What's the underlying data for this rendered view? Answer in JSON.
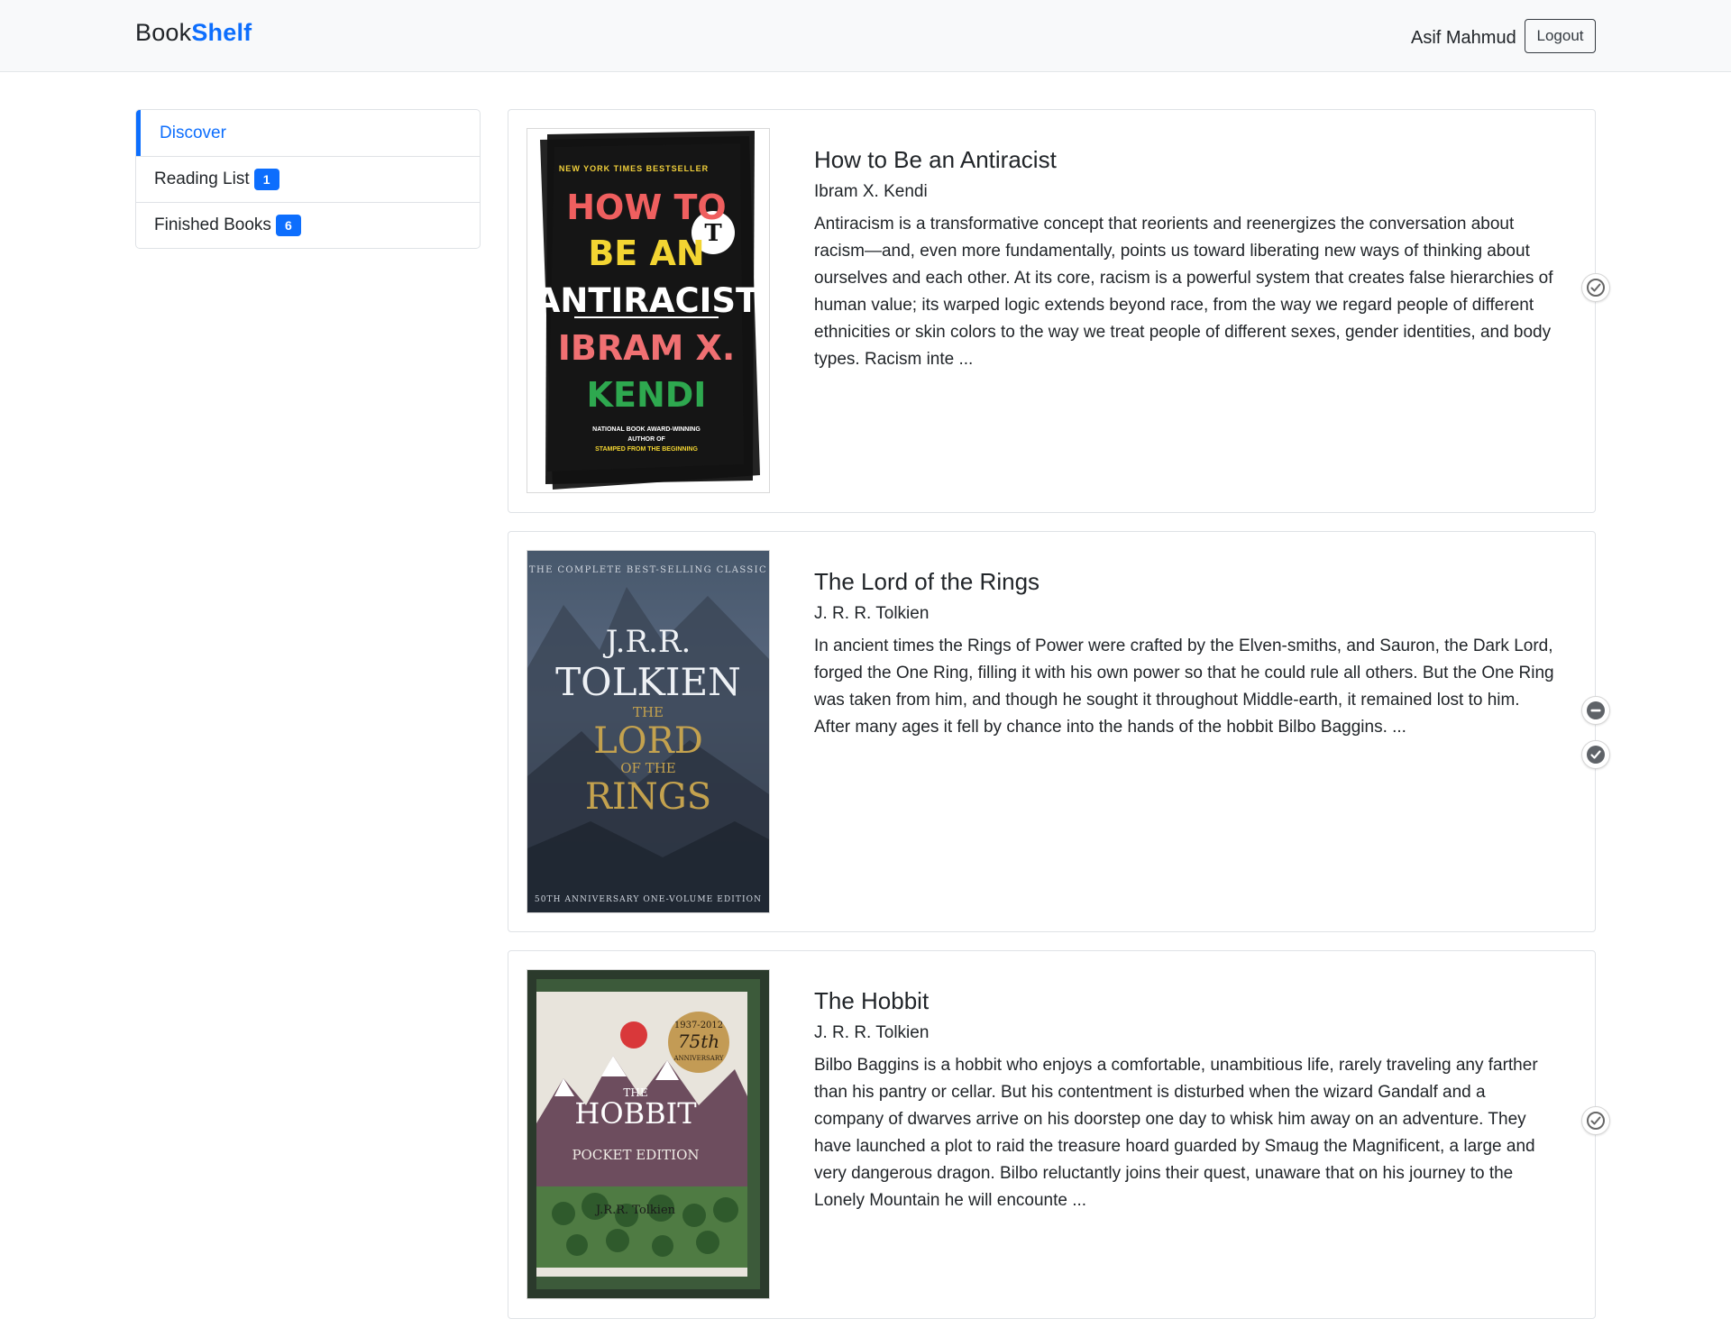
{
  "navbar": {
    "brand_part1": "Book",
    "brand_part2": "Shelf",
    "user_name": "Asif Mahmud",
    "logout_label": "Logout"
  },
  "sidebar": {
    "items": [
      {
        "label": "Discover",
        "active": true
      },
      {
        "label": "Reading List",
        "badge": "1"
      },
      {
        "label": "Finished Books",
        "badge": "6"
      }
    ]
  },
  "books": [
    {
      "title": "How to Be an Antiracist",
      "author": "Ibram X. Kendi",
      "synopsis": "Antiracism is a transformative concept that reorients and reenergizes the conversation about racism—and, even more fundamentally, points us toward liberating new ways of thinking about ourselves and each other. At its core, racism is a powerful system that creates false hierarchies of human value; its warped logic extends beyond race, from the way we regard people of different ethnicities or skin colors to the way we treat people of different sexes, gender identities, and body types. Racism inte ...",
      "cover": {
        "top_line": "NEW YORK TIMES BESTSELLER",
        "lines": [
          "HOW TO",
          "BE AN",
          "ANTIRACIST",
          "IBRAM X.",
          "KENDI"
        ],
        "bottom_lines": [
          "NATIONAL BOOK AWARD-WINNING",
          "AUTHOR OF",
          "STAMPED FROM THE BEGINNING"
        ]
      },
      "actions": [
        "mark-read-icon"
      ]
    },
    {
      "title": "The Lord of the Rings",
      "author": "J. R. R. Tolkien",
      "synopsis": "In ancient times the Rings of Power were crafted by the Elven-smiths, and Sauron, the Dark Lord, forged the One Ring, filling it with his own power so that he could rule all others. But the One Ring was taken from him, and though he sought it throughout Middle-earth, it remained lost to him. After many ages it fell by chance into the hands of the hobbit Bilbo Baggins. ...",
      "cover": {
        "top_line": "THE COMPLETE BEST-SELLING CLASSIC",
        "author_line1": "J.R.R.",
        "author_line2": "TOLKIEN",
        "title_lines": [
          "THE",
          "LORD",
          "OF THE",
          "RINGS"
        ],
        "bottom_line": "50TH ANNIVERSARY ONE-VOLUME EDITION"
      },
      "actions": [
        "remove-from-list-icon",
        "mark-finished-icon"
      ]
    },
    {
      "title": "The Hobbit",
      "author": "J. R. R. Tolkien",
      "synopsis": "Bilbo Baggins is a hobbit who enjoys a comfortable, unambitious life, rarely traveling any farther than his pantry or cellar. But his contentment is disturbed when the wizard Gandalf and a company of dwarves arrive on his doorstep one day to whisk him away on an adventure. They have launched a plot to raid the treasure hoard guarded by Smaug the Magnificent, a large and very dangerous dragon. Bilbo reluctantly joins their quest, unaware that on his journey to the Lonely Mountain he will encounte ...",
      "cover": {
        "badge_years": "1937-2012",
        "badge_big": "75th",
        "badge_word": "ANNIVERSARY",
        "title_small": "THE",
        "title_big": "HOBBIT",
        "edition": "POCKET EDITION",
        "author": "J.R.R. Tolkien"
      },
      "actions": [
        "mark-read-icon"
      ]
    }
  ],
  "colors": {
    "accent": "#0d6efd",
    "navbar_bg": "#f8f9fa",
    "border": "#dfe2e6",
    "text": "#212529"
  }
}
